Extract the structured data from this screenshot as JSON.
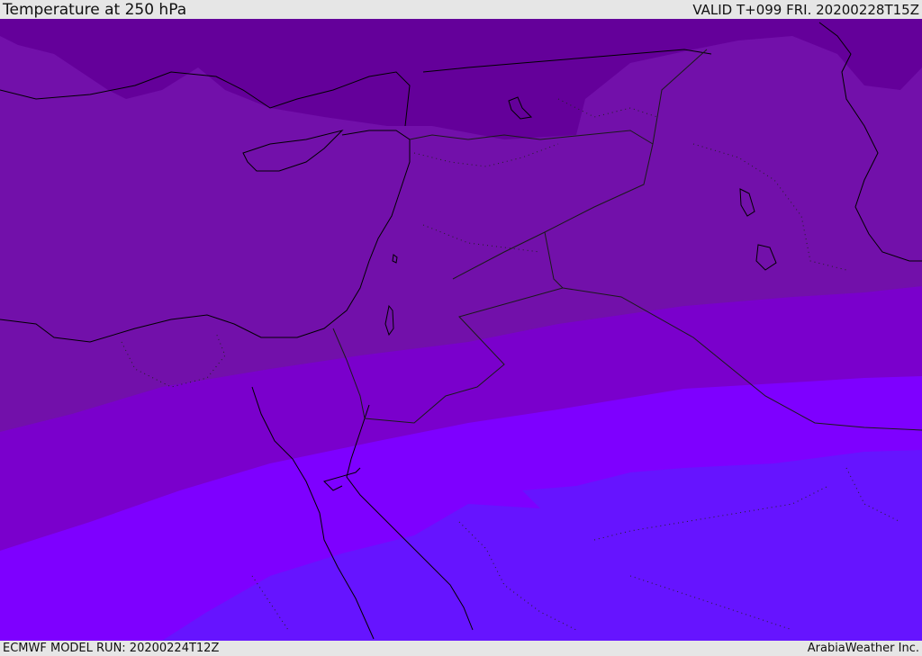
{
  "header": {
    "title": "Temperature at 250 hPa",
    "valid": "VALID T+099 FRI. 20200228T15Z"
  },
  "footer": {
    "model_run": "ECMWF MODEL RUN: 20200224T12Z",
    "credit": "ArabiaWeather Inc."
  },
  "map": {
    "field": "temperature",
    "level": "250 hPa",
    "colors": {
      "darkest_band": "#64009a",
      "dark_band": "#7210aa",
      "mid_band": "#7a00cc",
      "bright_band": "#7e00ff",
      "blue_band": "#6614ff",
      "coastline": "#000000",
      "border": "#1a1a1a"
    }
  }
}
